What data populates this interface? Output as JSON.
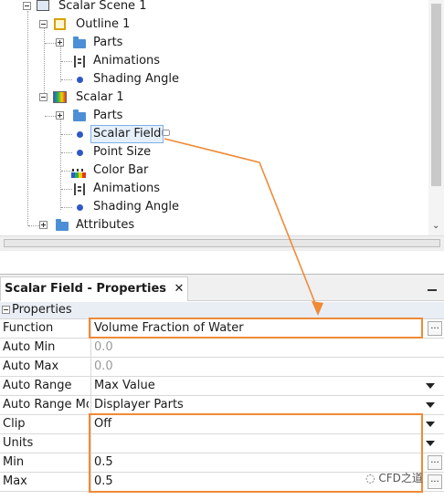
{
  "tree": {
    "items": [
      {
        "label": "Scalar Scene 1",
        "icon": "scene-icon"
      },
      {
        "label": "Outline 1",
        "icon": "outline-displayer-icon"
      },
      {
        "label": "Parts",
        "icon": "folder-icon"
      },
      {
        "label": "Animations",
        "icon": "film-icon"
      },
      {
        "label": "Shading Angle",
        "icon": "dot-icon"
      },
      {
        "label": "Scalar 1",
        "icon": "scalar-displayer-icon"
      },
      {
        "label": "Parts",
        "icon": "folder-icon"
      },
      {
        "label": "Scalar Field",
        "icon": "dot-icon"
      },
      {
        "label": "Point Size",
        "icon": "dot-icon"
      },
      {
        "label": "Color Bar",
        "icon": "color-bar-icon"
      },
      {
        "label": "Animations",
        "icon": "film-icon"
      },
      {
        "label": "Shading Angle",
        "icon": "dot-icon"
      },
      {
        "label": "Attributes",
        "icon": "folder-icon"
      }
    ]
  },
  "properties": {
    "tab_title": "Scalar Field - Properties",
    "close_glyph": "✕",
    "section": "Properties",
    "rows": [
      {
        "name": "Function",
        "value": "Volume Fraction of Water"
      },
      {
        "name": "Auto Min",
        "value": "0.0"
      },
      {
        "name": "Auto Max",
        "value": "0.0"
      },
      {
        "name": "Auto Range",
        "value": "Max Value"
      },
      {
        "name": "Auto Range Mode",
        "value": "Displayer Parts"
      },
      {
        "name": "Clip",
        "value": "Off"
      },
      {
        "name": "Units",
        "value": ""
      },
      {
        "name": "Min",
        "value": "0.5"
      },
      {
        "name": "Max",
        "value": "0.5"
      }
    ],
    "ellipsis": "..."
  },
  "colors": {
    "annotation": "#f08a36",
    "selection": "#e6f0fb",
    "icon_blue": "#2f58c4"
  },
  "watermark": "CFD之道"
}
